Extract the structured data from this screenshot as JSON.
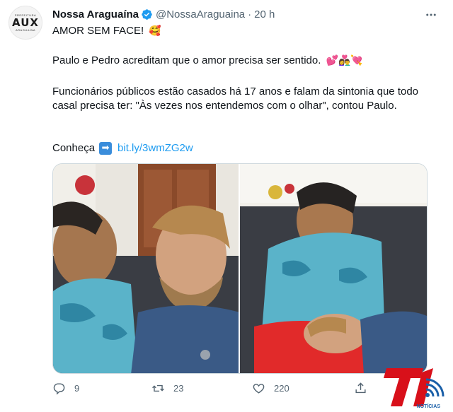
{
  "account": {
    "name": "Nossa Araguaína",
    "handle": "@NossaAraguaina",
    "separator": "·",
    "time": "20 h",
    "avatar_top_text": "PREFEITURA",
    "avatar_brand": "AUX",
    "avatar_bottom_text": "ARAGUAÍNA"
  },
  "tweet": {
    "line1": "AMOR SEM FACE!",
    "line2": "Paulo e Pedro acreditam que o amor precisa ser sentido.",
    "line3": "Funcionários públicos estão casados há 17 anos e falam da sintonia que todo casal precisa ter: \"Às vezes nos entendemos com o olhar\", contou Paulo.",
    "line4_prefix": "Conheça",
    "link": "bit.ly/3wmZG2w",
    "emojis": {
      "line1": "🥰",
      "line2": "💕👩‍❤️‍👨💘",
      "arrow": "➡"
    }
  },
  "actions": {
    "reply_count": "9",
    "retweet_count": "23",
    "like_count": "220"
  },
  "watermark": {
    "brand": "T1",
    "label": "NOTÍCIAS"
  },
  "colors": {
    "accent": "#1d9bf0",
    "verified": "#1d9bf0",
    "muted": "#536471",
    "watermark_red": "#d8101a",
    "watermark_blue": "#1a5fa8"
  },
  "icons": [
    "verified-badge-icon",
    "more-icon",
    "reply-icon",
    "retweet-icon",
    "like-icon",
    "share-icon",
    "arrow-right-emoji-icon"
  ]
}
